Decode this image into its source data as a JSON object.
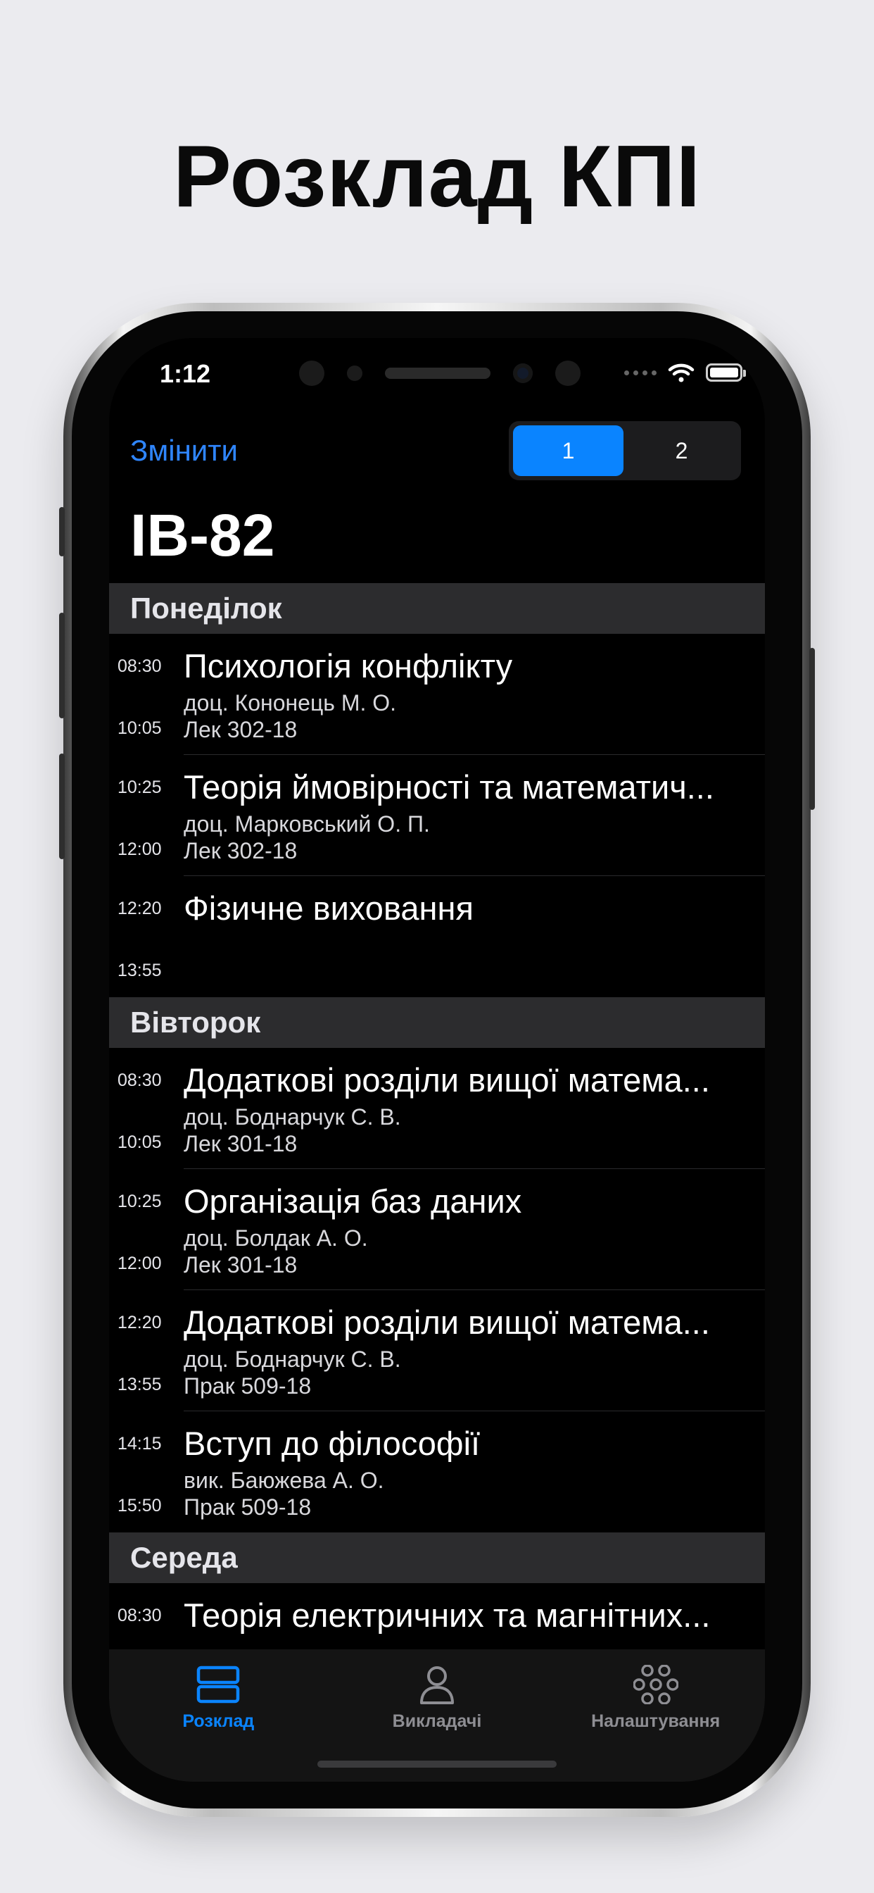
{
  "headline": "Розклад КПІ",
  "status": {
    "time": "1:12"
  },
  "nav": {
    "change_label": "Змінити",
    "weeks": [
      "1",
      "2"
    ],
    "selected_week": "1"
  },
  "group_title": "ІВ-82",
  "days": [
    {
      "name": "Понеділок",
      "lessons": [
        {
          "start": "08:30",
          "end": "10:05",
          "name": "Психологія конфлікту",
          "teacher": "доц. Кононець М. О.",
          "room": "Лек 302-18"
        },
        {
          "start": "10:25",
          "end": "12:00",
          "name": "Теорія ймовірності та математич...",
          "teacher": "доц. Марковський О. П.",
          "room": "Лек 302-18"
        },
        {
          "start": "12:20",
          "end": "13:55",
          "name": "Фізичне виховання",
          "teacher": "",
          "room": ""
        }
      ]
    },
    {
      "name": "Вівторок",
      "lessons": [
        {
          "start": "08:30",
          "end": "10:05",
          "name": "Додаткові розділи вищої матема...",
          "teacher": "доц. Боднарчук С. В.",
          "room": "Лек 301-18"
        },
        {
          "start": "10:25",
          "end": "12:00",
          "name": "Організація баз даних",
          "teacher": "доц. Болдак А. О.",
          "room": "Лек 301-18"
        },
        {
          "start": "12:20",
          "end": "13:55",
          "name": "Додаткові розділи вищої матема...",
          "teacher": "доц. Боднарчук С. В.",
          "room": "Прак 509-18"
        },
        {
          "start": "14:15",
          "end": "15:50",
          "name": "Вступ до філософії",
          "teacher": "вик. Баюжева А. О.",
          "room": "Прак 509-18"
        }
      ]
    },
    {
      "name": "Середа",
      "lessons": [
        {
          "start": "08:30",
          "end": "",
          "name": "Теорія електричних та магнітних...",
          "teacher": "",
          "room": ""
        }
      ]
    }
  ],
  "tabs": [
    {
      "label": "Розклад",
      "icon": "schedule-icon",
      "active": true
    },
    {
      "label": "Викладачі",
      "icon": "person-icon",
      "active": false
    },
    {
      "label": "Налаштування",
      "icon": "settings-icon",
      "active": false
    }
  ],
  "colors": {
    "accent": "#0a84ff",
    "link": "#2f86ff",
    "background": "#ebebef"
  }
}
